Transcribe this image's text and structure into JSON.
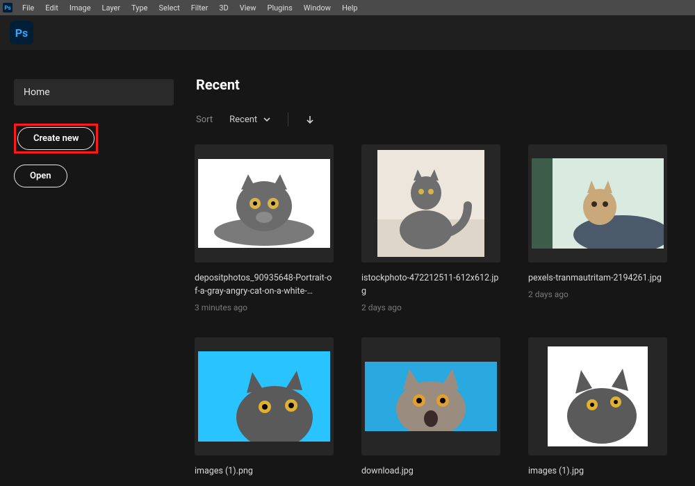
{
  "menu": {
    "items": [
      "File",
      "Edit",
      "Image",
      "Layer",
      "Type",
      "Select",
      "Filter",
      "3D",
      "View",
      "Plugins",
      "Window",
      "Help"
    ]
  },
  "app": {
    "logo_text": "Ps"
  },
  "sidebar": {
    "home_label": "Home",
    "create_label": "Create new",
    "open_label": "Open"
  },
  "main": {
    "section_title": "Recent",
    "sort_label": "Sort",
    "sort_value": "Recent"
  },
  "recent_files": [
    {
      "name": "depositphotos_90935648-Portrait-of-a-gray-angry-cat-on-a-white-…",
      "time": "3 minutes ago",
      "size": "a",
      "thumb_bg": "#ffffff"
    },
    {
      "name": "istockphoto-472212511-612x612.jpg",
      "time": "2 days ago",
      "size": "b",
      "thumb_bg": "#ede7de"
    },
    {
      "name": "pexels-tranmautritam-2194261.jpg",
      "time": "2 days ago",
      "size": "c",
      "thumb_bg": "#cfe3d8"
    },
    {
      "name": "images (1).png",
      "time": "",
      "size": "d",
      "thumb_bg": "#29c4ff"
    },
    {
      "name": "download.jpg",
      "time": "",
      "size": "e",
      "thumb_bg": "#2aa9e0"
    },
    {
      "name": "images (1).jpg",
      "time": "",
      "size": "f",
      "thumb_bg": "#ffffff"
    }
  ]
}
